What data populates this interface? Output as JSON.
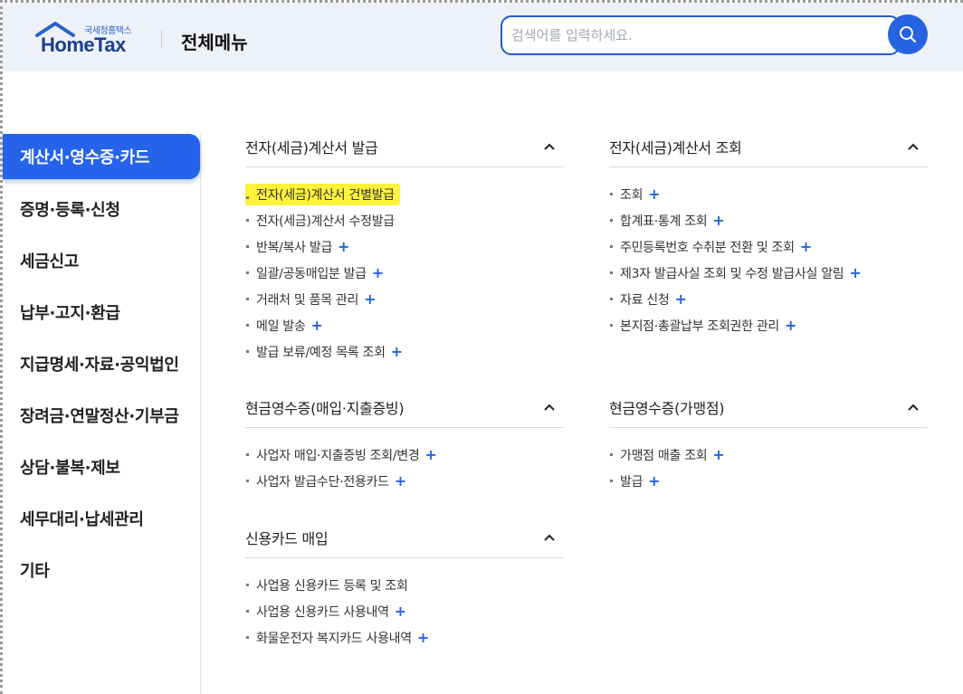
{
  "header": {
    "logo_sub": "국세청홈택스",
    "logo_main": "HomeTax",
    "title": "전체메뉴",
    "search_placeholder": "검색어를 입력하세요.",
    "accent": "#2563e0"
  },
  "sidebar": {
    "items": [
      {
        "label": "계산서·영수증·카드",
        "active": true
      },
      {
        "label": "증명·등록·신청"
      },
      {
        "label": "세금신고"
      },
      {
        "label": "납부·고지·환급"
      },
      {
        "label": "지급명세·자료·공익법인"
      },
      {
        "label": "장려금·연말정산·기부금"
      },
      {
        "label": "상담·불복·제보"
      },
      {
        "label": "세무대리·납세관리"
      },
      {
        "label": "기타"
      }
    ]
  },
  "sections": {
    "s1": {
      "title": "전자(세금)계산서 발급",
      "links": [
        {
          "label": "전자(세금)계산서 건별발급",
          "highlighted": true
        },
        {
          "label": "전자(세금)계산서 수정발급"
        },
        {
          "label": "반복/복사 발급",
          "plus": "+"
        },
        {
          "label": "일괄/공동매입분 발급",
          "plus": "+"
        },
        {
          "label": "거래처 및 품목 관리",
          "plus": "+"
        },
        {
          "label": "메일 발송",
          "plus": "+"
        },
        {
          "label": "발급 보류/예정 목록 조회",
          "plus": "+"
        }
      ]
    },
    "s2": {
      "title": "전자(세금)계산서 조회",
      "links": [
        {
          "label": "조회",
          "plus": "+"
        },
        {
          "label": "합계표·통계 조회",
          "plus": "+"
        },
        {
          "label": "주민등록번호 수취분 전환 및 조회",
          "plus": "+"
        },
        {
          "label": "제3자 발급사실 조회 및 수정 발급사실 알림",
          "plus": "+"
        },
        {
          "label": "자료 신청",
          "plus": "+"
        },
        {
          "label": "본지점·총괄납부 조회권한 관리",
          "plus": "+"
        }
      ]
    },
    "s3": {
      "title": "현금영수증(매입·지출증빙)",
      "links": [
        {
          "label": "사업자 매입·지출증빙 조회/변경",
          "plus": "+"
        },
        {
          "label": "사업자 발급수단·전용카드",
          "plus": "+"
        }
      ]
    },
    "s4": {
      "title": "현금영수증(가맹점)",
      "links": [
        {
          "label": "가맹점 매출 조회",
          "plus": "+"
        },
        {
          "label": "발급",
          "plus": "+"
        }
      ]
    },
    "s5": {
      "title": "신용카드 매입",
      "links": [
        {
          "label": "사업용 신용카드 등록 및 조회"
        },
        {
          "label": "사업용 신용카드 사용내역",
          "plus": "+"
        },
        {
          "label": "화물운전자 복지카드 사용내역",
          "plus": "+"
        }
      ]
    }
  }
}
